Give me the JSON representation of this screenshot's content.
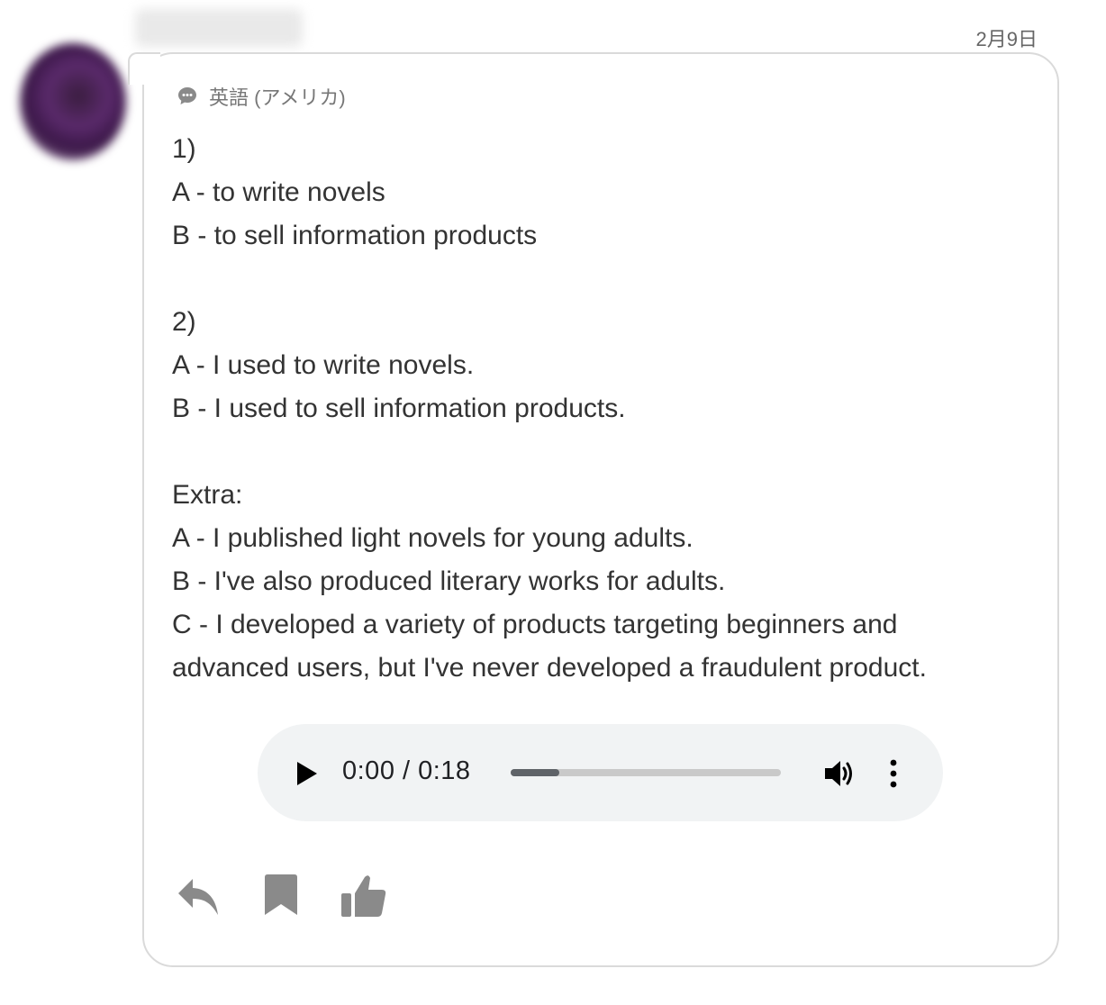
{
  "header": {
    "date": "2月9日"
  },
  "card": {
    "language_label": "英語 (アメリカ)",
    "message": {
      "section1": {
        "heading": "1)",
        "lines": [
          "A - to write novels",
          "B - to sell information products"
        ]
      },
      "section2": {
        "heading": "2)",
        "lines": [
          "A - I used to write novels.",
          "B - I used to sell information products."
        ]
      },
      "section3": {
        "heading": "Extra:",
        "lines": [
          "A - I published light novels for young adults.",
          "B - I've also produced literary works for adults.",
          "C - I developed a variety of products targeting beginners and",
          "advanced users, but I've never developed a fraudulent product."
        ]
      }
    },
    "audio": {
      "time_display": "0:00 / 0:18",
      "progress_fraction": 0.18
    },
    "actions": {
      "reply_icon": "reply-icon",
      "bookmark_icon": "bookmark-icon",
      "like_icon": "thumbs-up-icon"
    }
  },
  "colors": {
    "card_border": "#dadada",
    "text": "#333333",
    "muted_text": "#777777",
    "audio_bg": "#f1f3f4",
    "icon_gray": "#8a8a8a"
  }
}
